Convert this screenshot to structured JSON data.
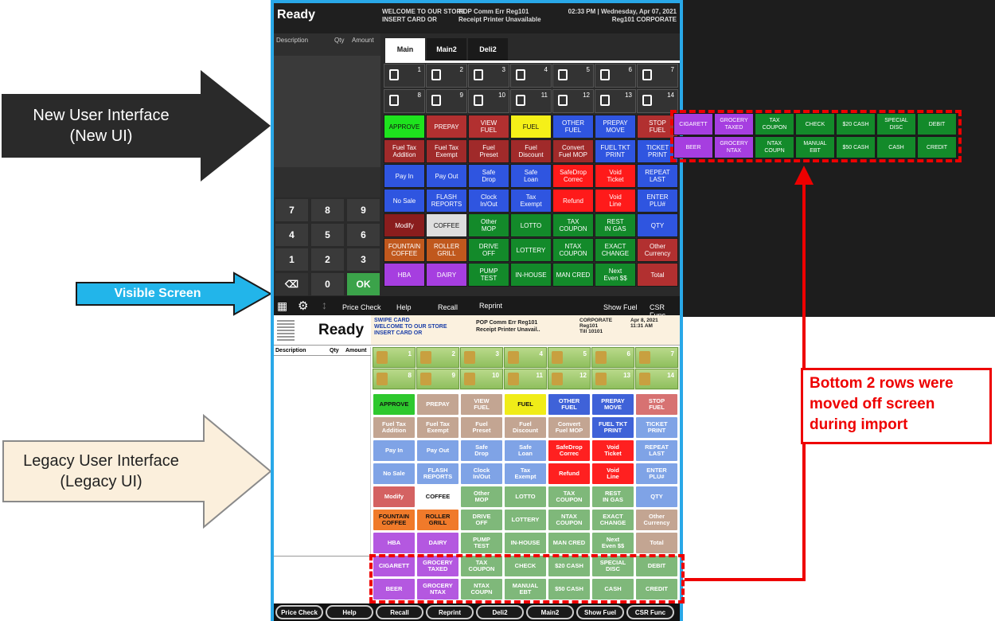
{
  "annotations": {
    "new_ui_label": "New User Interface\n(New UI)",
    "visible_screen_label": "Visible Screen",
    "legacy_ui_label": "Legacy User Interface\n(Legacy UI)",
    "bottom_rows_note": "Bottom 2 rows were moved off screen during import"
  },
  "new_ui": {
    "status": "Ready",
    "msg1": "WELCOME TO OUR STORE",
    "msg2": "INSERT CARD OR",
    "msg3": "POP Comm Err Reg101",
    "msg4": "Receipt Printer Unavailable",
    "time": "02:33 PM | Wednesday, Apr 07, 2021",
    "reg": "Reg101  CORPORATE",
    "col_desc": "Description",
    "col_qty": "Qty",
    "col_amount": "Amount",
    "tabs": [
      "Main",
      "Main2",
      "Deli2"
    ],
    "pumps": [
      "1",
      "2",
      "3",
      "4",
      "5",
      "6",
      "7",
      "8",
      "9",
      "10",
      "11",
      "12",
      "13",
      "14"
    ],
    "keypad": [
      "7",
      "8",
      "9",
      "4",
      "5",
      "6",
      "1",
      "2",
      "3",
      "⌫",
      "0",
      "OK"
    ],
    "bottom": [
      "Price Check",
      "Help",
      "Recall",
      "Reprint",
      "Show Fuel",
      "CSR Func"
    ],
    "grid": [
      [
        "APPROVE",
        "PREPAY",
        "VIEW\nFUEL",
        "FUEL",
        "OTHER\nFUEL",
        "PREPAY\nMOVE",
        "STOP\nFUEL"
      ],
      [
        "Fuel Tax\nAddition",
        "Fuel Tax\nExempt",
        "Fuel\nPreset",
        "Fuel\nDiscount",
        "Convert\nFuel MOP",
        "FUEL TKT\nPRINT",
        "TICKET\nPRINT"
      ],
      [
        "Pay In",
        "Pay Out",
        "Safe\nDrop",
        "Safe\nLoan",
        "SafeDrop\nCorrec",
        "Void\nTicket",
        "REPEAT\nLAST"
      ],
      [
        "No Sale",
        "FLASH\nREPORTS",
        "Clock\nIn/Out",
        "Tax\nExempt",
        "Refund",
        "Void\nLine",
        "ENTER\nPLU#"
      ],
      [
        "Modify",
        "COFFEE",
        "Other\nMOP",
        "LOTTO",
        "TAX\nCOUPON",
        "REST\nIN GAS",
        "QTY"
      ],
      [
        "FOUNTAIN\nCOFFEE",
        "ROLLER\nGRILL",
        "DRIVE\nOFF",
        "LOTTERY",
        "NTAX\nCOUPON",
        "EXACT\nCHANGE",
        "Other\nCurrency"
      ],
      [
        "HBA",
        "DAIRY",
        "PUMP\nTEST",
        "IN-HOUSE",
        "MAN CRED",
        "Next\nEven $$",
        "Total"
      ]
    ],
    "offscreen": [
      [
        "CIGARETT",
        "GROCERY\nTAXED",
        "TAX\nCOUPON",
        "CHECK",
        "$20 CASH",
        "SPECIAL\nDISC",
        "DEBIT"
      ],
      [
        "BEER",
        "GROCERY\nNTAX",
        "NTAX\nCOUPN",
        "MANUAL\nEBT",
        "$50 CASH",
        "CASH",
        "CREDIT"
      ]
    ]
  },
  "legacy": {
    "status": "Ready",
    "msg1": "SWIPE CARD",
    "msg2": "WELCOME TO OUR STORE",
    "msg3": "INSERT CARD OR",
    "msg4": "POP Comm Err Reg101",
    "msg5": "Receipt Printer Unavail..",
    "corp": "CORPORATE\nReg101\nTill 10101",
    "date": "Apr 8, 2021\n11:31 AM",
    "col_desc": "Description",
    "col_qty": "Qty",
    "col_amount": "Amount",
    "bottom": [
      "Price Check",
      "Help",
      "Recall",
      "Reprint",
      "Deli2",
      "Main2",
      "Show Fuel",
      "CSR Func"
    ]
  }
}
